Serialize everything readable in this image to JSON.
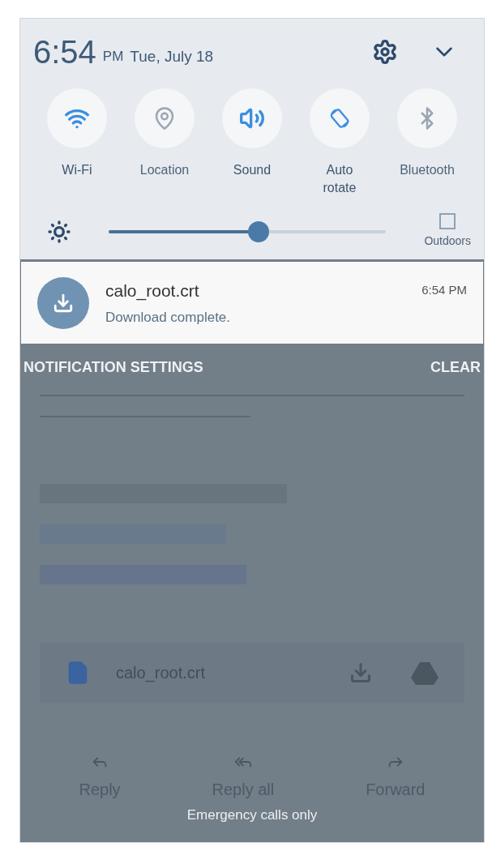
{
  "status": {
    "time": "6:54",
    "ampm": "PM",
    "date": "Tue, July 18"
  },
  "toggles": [
    {
      "kind": "wifi",
      "label": "Wi-Fi",
      "on": true
    },
    {
      "kind": "location",
      "label": "Location",
      "on": false
    },
    {
      "kind": "sound",
      "label": "Sound",
      "on": true
    },
    {
      "kind": "rotate",
      "label": "Auto rotate",
      "on": true
    },
    {
      "kind": "bluetooth",
      "label": "Bluetooth",
      "on": false
    }
  ],
  "brightness": {
    "level": 0.54,
    "outdoors": {
      "label": "Outdoors",
      "checked": false
    }
  },
  "notification": {
    "title": "calo_root.crt",
    "text": "Download complete.",
    "time": "6:54 PM"
  },
  "notification_bar": {
    "settings": "NOTIFICATION SETTINGS",
    "clear": "CLEAR"
  },
  "attachment": {
    "name": "calo_root.crt"
  },
  "actions": [
    {
      "kind": "reply",
      "label": "Reply"
    },
    {
      "kind": "reply_all",
      "label": "Reply all"
    },
    {
      "kind": "forward",
      "label": "Forward"
    }
  ],
  "footer": "Emergency calls only"
}
